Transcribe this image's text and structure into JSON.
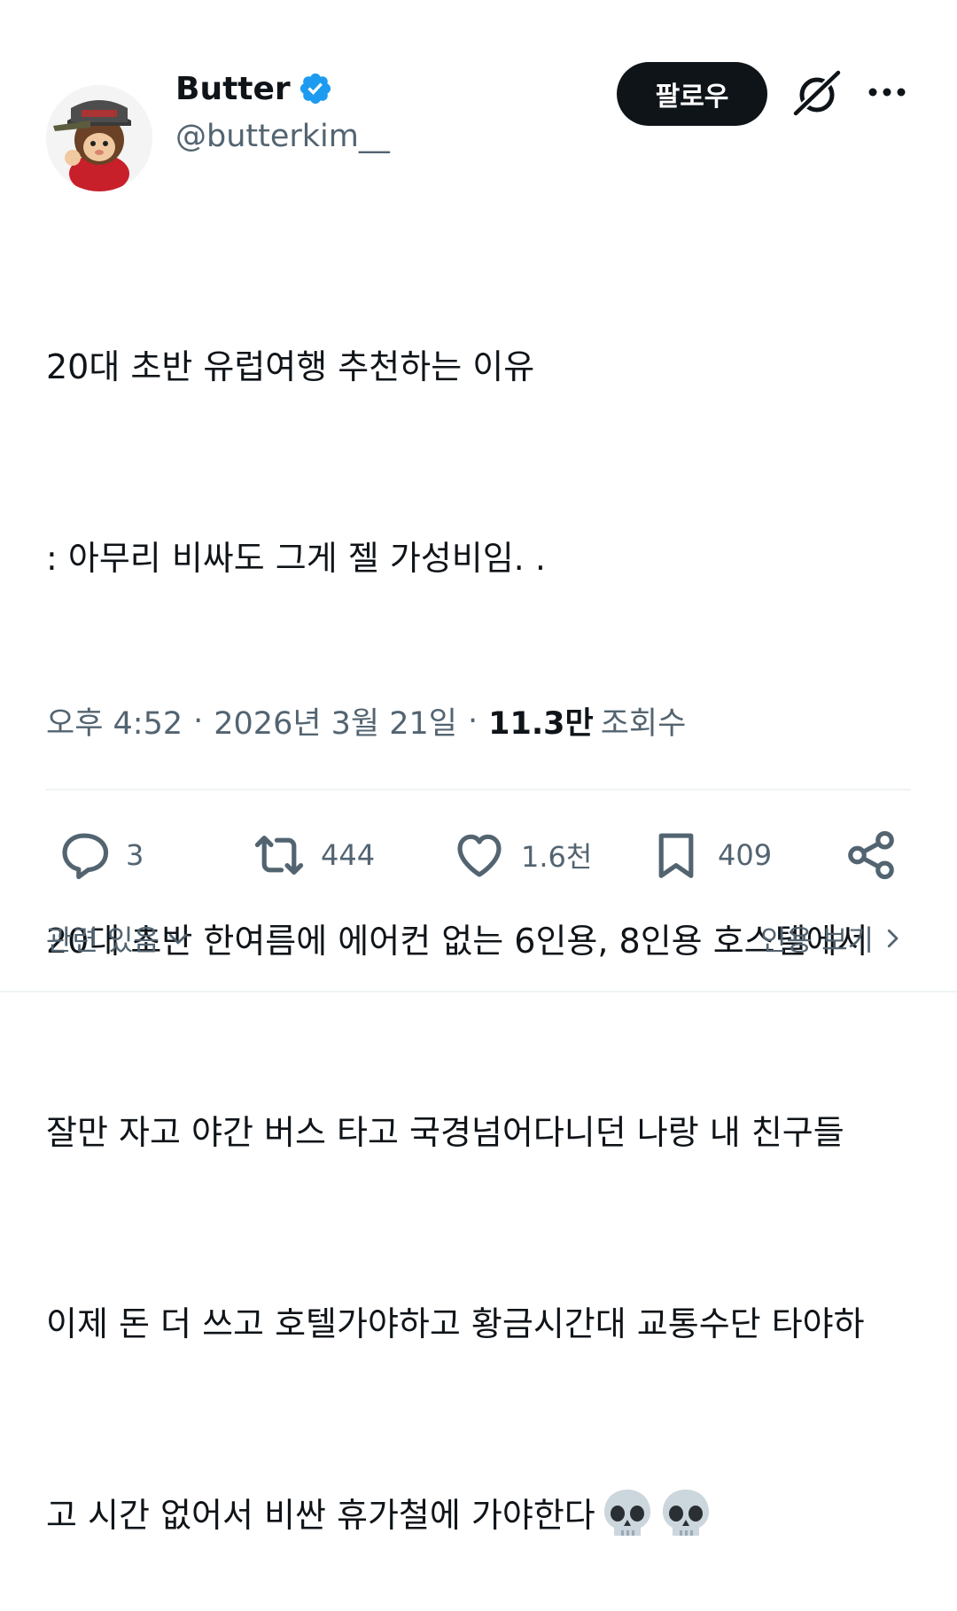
{
  "author": {
    "display_name": "Butter",
    "handle": "@butterkim__",
    "verified": true,
    "avatar_icon": "avatar-monchhichi-with-cap"
  },
  "header": {
    "follow_label": "팔로우",
    "grok_icon": "grok-icon",
    "more_icon": "more-icon"
  },
  "tweet": {
    "lines": [
      "20대 초반 유럽여행 추천하는 이유",
      ": 아무리 비싸도 그게 젤 가성비임. .",
      "",
      "20대 초반 한여름에 에어컨 없는 6인용, 8인용 호스텔에서",
      "잘만 자고 야간 버스 타고 국경넘어다니던 나랑 내 친구들",
      "이제 돈 더 쓰고 호텔가야하고 황금시간대 교통수단 타야하",
      "고 시간 없어서 비싼 휴가철에 가야한다"
    ],
    "trailing_emoji": [
      "skull",
      "skull"
    ]
  },
  "meta": {
    "time": "오후 4:52",
    "date": "2026년 3월 21일",
    "views_count": "11.3만",
    "views_label": "조회수"
  },
  "actions": {
    "reply_count": "3",
    "retweet_count": "444",
    "like_count": "1.6천",
    "bookmark_count": "409"
  },
  "footer": {
    "related_label": "관련 있음",
    "quotes_label": "인용 보기"
  },
  "colors": {
    "text": "#0f1419",
    "secondary": "#536471",
    "verified": "#1d9bf0",
    "divider": "#eff3f4"
  }
}
